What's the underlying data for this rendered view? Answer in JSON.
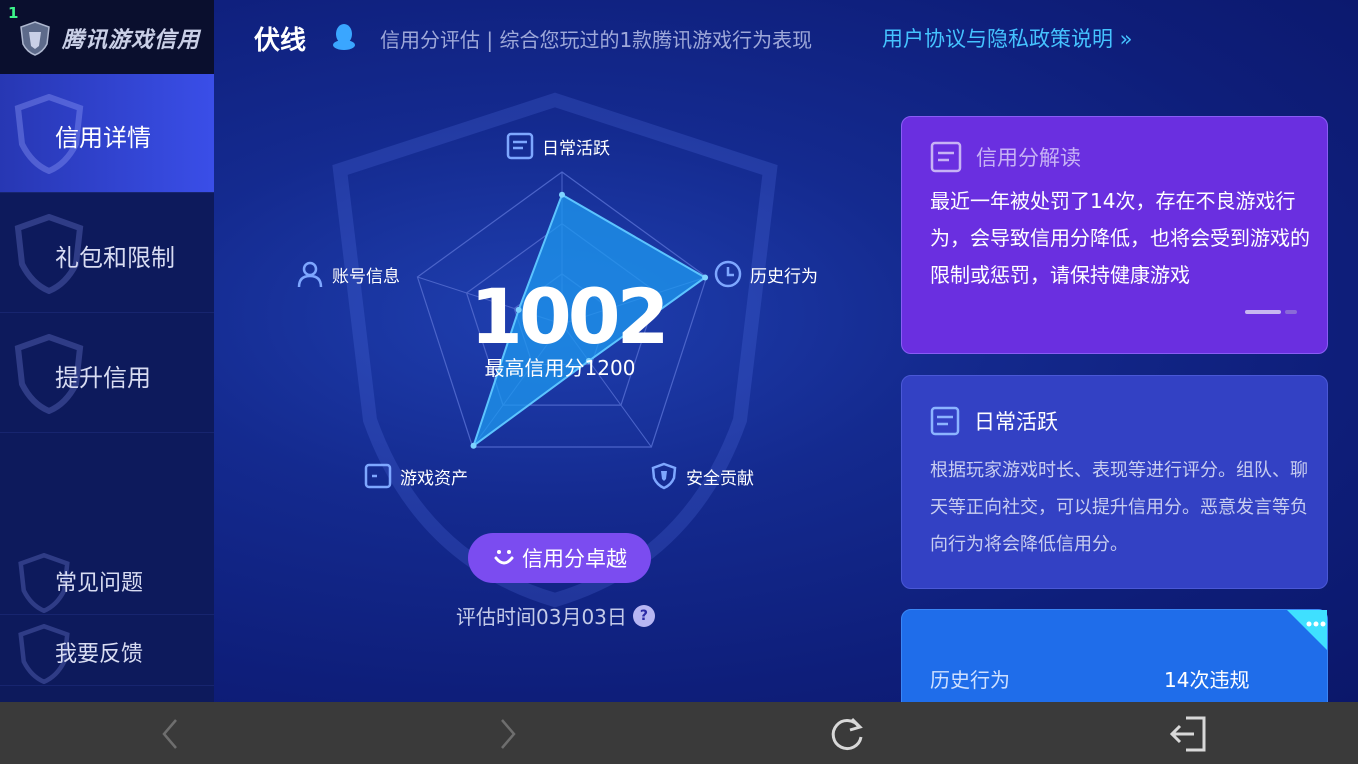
{
  "app": {
    "badge_number": "1",
    "logo_text": "腾讯游戏信用"
  },
  "sidebar": {
    "items": [
      {
        "label": "信用详情"
      },
      {
        "label": "礼包和限制"
      },
      {
        "label": "提升信用"
      },
      {
        "label": "常见问题"
      },
      {
        "label": "我要反馈"
      }
    ]
  },
  "header": {
    "player_name": "伏线",
    "description": "信用分评估 | 综合您玩过的1款腾讯游戏行为表现",
    "link": "用户协议与隐私政策说明 »"
  },
  "radar": {
    "score": "1002",
    "max_score": "最高信用分1200",
    "dimensions": [
      {
        "label": "日常活跃",
        "icon": "document-icon"
      },
      {
        "label": "历史行为",
        "icon": "clock-icon"
      },
      {
        "label": "安全贡献",
        "icon": "shield-icon"
      },
      {
        "label": "游戏资产",
        "icon": "wallet-icon"
      },
      {
        "label": "账号信息",
        "icon": "user-icon"
      }
    ],
    "values": [
      0.85,
      0.99,
      0.3,
      0.99,
      0.3
    ],
    "rating_button": "信用分卓越",
    "eval_time": "评估时间03月03日",
    "help": "?"
  },
  "cards": {
    "interpretation": {
      "title": "信用分解读",
      "body": "最近一年被处罚了14次，存在不良游戏行为，会导致信用分降低，也将会受到游戏的限制或惩罚，请保持健康游戏"
    },
    "daily": {
      "title": "日常活跃",
      "body": "根据玩家游戏时长、表现等进行评分。组队、聊天等正向社交，可以提升信用分。恶意发言等负向行为将会降低信用分。"
    },
    "history": {
      "label": "历史行为",
      "value": "14次违规"
    }
  },
  "colors": {
    "accent_purple": "#6a2fe0",
    "radar_fill": "#1e9af0",
    "link_blue": "#45c3ff",
    "rating_button": "#7b4cf0"
  }
}
